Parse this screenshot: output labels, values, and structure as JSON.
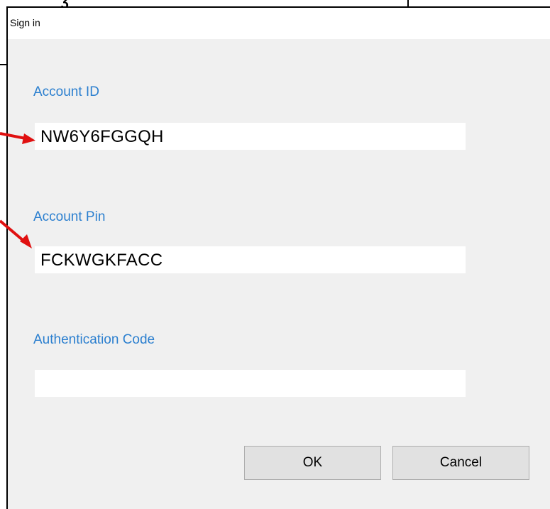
{
  "dialog": {
    "title": "Sign in",
    "fields": {
      "account_id": {
        "label": "Account ID",
        "value": "NW6Y6FGGQH"
      },
      "account_pin": {
        "label": "Account Pin",
        "value": "FCKWGKFACC"
      },
      "auth_code": {
        "label": "Authentication Code",
        "value": ""
      }
    },
    "buttons": {
      "ok": "OK",
      "cancel": "Cancel"
    }
  },
  "colors": {
    "label_blue": "#2b7fcf",
    "annotation_red": "#e01010",
    "dialog_bg": "#f0f0f0",
    "button_bg": "#e1e1e1"
  }
}
